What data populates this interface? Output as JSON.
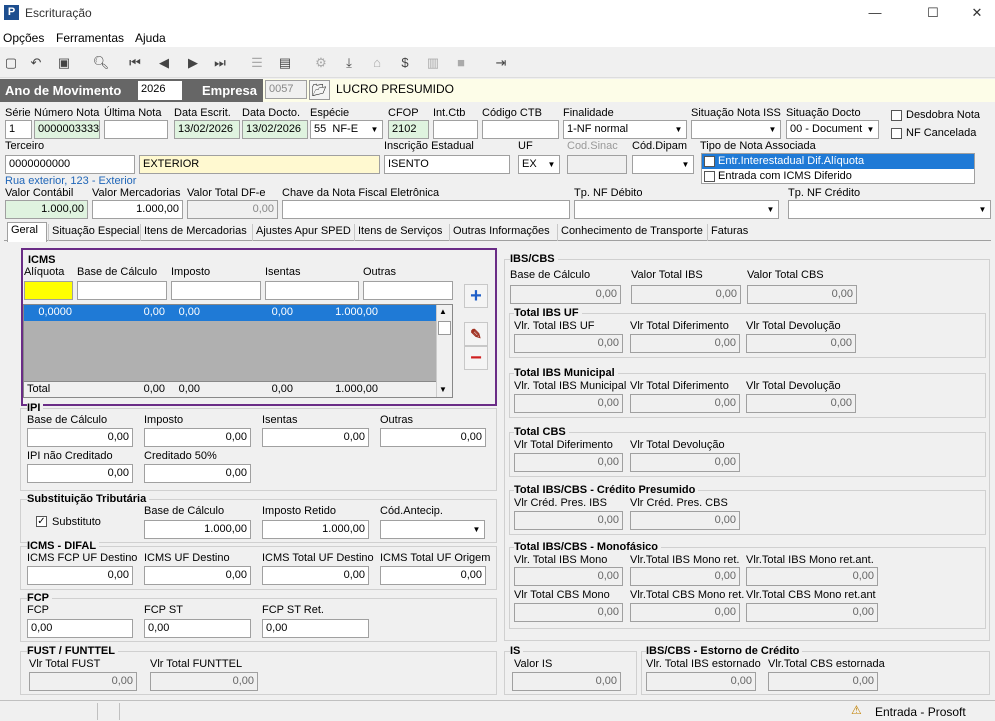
{
  "window": {
    "title": "Escrituração",
    "logo": "P",
    "min": "—",
    "max": "☐",
    "close": "✕"
  },
  "menu": [
    "Opções",
    "Ferramentas",
    "Ajuda"
  ],
  "header": {
    "ano_label": "Ano de Movimento",
    "ano_value": "2026",
    "empresa_label": "Empresa",
    "empresa_code": "0057",
    "empresa_name": "LUCRO PRESUMIDO"
  },
  "nf": {
    "serie_label": "Série",
    "serie": "1",
    "numero_label": "Número Nota",
    "numero": "0000003333",
    "ultima_label": "Última Nota",
    "ultima": "",
    "data_escrit_label": "Data Escrit.",
    "data_escrit": "13/02/2026",
    "data_docto_label": "Data Docto.",
    "data_docto": "13/02/2026",
    "especie_label": "Espécie",
    "especie_code": "55",
    "especie": "NF-E",
    "cfop_label": "CFOP",
    "cfop": "2102",
    "intctb_label": "Int.Ctb",
    "intctb": "",
    "codctb_label": "Código CTB",
    "codctb": "",
    "finalidade_label": "Finalidade",
    "finalidade": "1-NF normal",
    "sitiss_label": "Situação Nota ISS",
    "sitiss": "",
    "sitdocto_label": "Situação Docto",
    "sitdocto": "00 - Document",
    "desdobra_label": "Desdobra Nota",
    "nfcanc_label": "NF Cancelada",
    "terceiro_label": "Terceiro",
    "terceiro_code": "0000000000",
    "terceiro_name": "EXTERIOR",
    "endereco": "Rua exterior, 123 - Exterior",
    "ie_label": "Inscrição Estadual",
    "ie": "ISENTO",
    "uf_label": "UF",
    "uf": "EX",
    "codsinac_label": "Cod.Sinac",
    "codsinac": "",
    "coddipam_label": "Cód.Dipam",
    "coddipam": "",
    "tipo_assoc_label": "Tipo de Nota Associada",
    "tipo_assoc_opts": [
      "Entr.Interestadual Dif.Alíquota",
      "Entrada com ICMS Diferido"
    ],
    "vcontabil_label": "Valor Contábil",
    "vcontabil": "1.000,00",
    "vmerc_label": "Valor Mercadorias",
    "vmerc": "1.000,00",
    "vdfe_label": "Valor Total DF-e",
    "vdfe": "0,00",
    "chave_label": "Chave da Nota Fiscal Eletrônica",
    "chave": "",
    "tpdeb_label": "Tp. NF Débito",
    "tpdeb": "",
    "tpcred_label": "Tp. NF Crédito",
    "tpcred": ""
  },
  "tabs": [
    "Geral",
    "Situação Especial",
    "Itens de Mercadorias",
    "Ajustes Apur SPED",
    "Itens de Serviços",
    "Outras Informações",
    "Conhecimento de Transporte",
    "Faturas"
  ],
  "icms": {
    "title": "ICMS",
    "aliquota_label": "Alíquota",
    "bc_label": "Base de Cálculo",
    "imposto_label": "Imposto",
    "isentas_label": "Isentas",
    "outras_label": "Outras",
    "row": [
      "0,0000",
      "0,00",
      "0,00",
      "0,00",
      "1.000,00"
    ],
    "total_label": "Total",
    "total": [
      "0,00",
      "0,00",
      "0,00",
      "1.000,00"
    ],
    "add": "+",
    "edit": "✎",
    "remove": "−"
  },
  "ipi": {
    "title": "IPI",
    "bc_label": "Base de Cálculo",
    "bc": "0,00",
    "imposto_label": "Imposto",
    "imposto": "0,00",
    "isentas_label": "Isentas",
    "isentas": "0,00",
    "outras_label": "Outras",
    "outras": "0,00",
    "naocred_label": "IPI não Creditado",
    "naocred": "0,00",
    "cred50_label": "Creditado 50%",
    "cred50": "0,00"
  },
  "st": {
    "title": "Substituição Tributária",
    "substituto_label": "Substituto",
    "bc_label": "Base de Cálculo",
    "bc": "1.000,00",
    "retido_label": "Imposto Retido",
    "retido": "1.000,00",
    "antecip_label": "Cód.Antecip.",
    "antecip": ""
  },
  "difal": {
    "title": "ICMS - DIFAL",
    "fcp_label": "ICMS FCP UF Destino",
    "fcp": "0,00",
    "ufdest_label": "ICMS UF Destino",
    "ufdest": "0,00",
    "totdest_label": "ICMS Total UF Destino",
    "totdest": "0,00",
    "totorig_label": "ICMS Total UF Origem",
    "totorig": "0,00"
  },
  "fcp": {
    "title": "FCP",
    "fcp_label": "FCP",
    "fcp": "0,00",
    "st_label": "FCP ST",
    "st": "0,00",
    "ret_label": "FCP ST Ret.",
    "ret": "0,00"
  },
  "fust": {
    "title": "FUST / FUNTTEL",
    "fust_label": "Vlr Total FUST",
    "fust": "0,00",
    "funttel_label": "Vlr Total FUNTTEL",
    "funttel": "0,00"
  },
  "ibscbs": {
    "title": "IBS/CBS",
    "bc_label": "Base de Cálculo",
    "bc": "0,00",
    "ibs_label": "Valor Total IBS",
    "ibs": "0,00",
    "cbs_label": "Valor Total CBS",
    "cbs": "0,00"
  },
  "ibsuf": {
    "title": "Total IBS UF",
    "a_label": "Vlr. Total IBS UF",
    "a": "0,00",
    "b_label": "Vlr Total Diferimento",
    "b": "0,00",
    "c_label": "Vlr Total Devolução",
    "c": "0,00"
  },
  "ibsmun": {
    "title": "Total IBS Municipal",
    "a_label": "Vlr. Total IBS Municipal",
    "a": "0,00",
    "b_label": "Vlr Total Diferimento",
    "b": "0,00",
    "c_label": "Vlr Total Devolução",
    "c": "0,00"
  },
  "cbs": {
    "title": "Total CBS",
    "a_label": "Vlr Total Diferimento",
    "a": "0,00",
    "b_label": "Vlr Total Devolução",
    "b": "0,00"
  },
  "presumido": {
    "title": "Total IBS/CBS - Crédito Presumido",
    "a_label": "Vlr Créd. Pres. IBS",
    "a": "0,00",
    "b_label": "Vlr Créd. Pres. CBS",
    "b": "0,00"
  },
  "mono": {
    "title": "Total IBS/CBS - Monofásico",
    "a_label": "Vlr. Total IBS Mono",
    "a": "0,00",
    "b_label": "Vlr.Total IBS Mono ret.",
    "b": "0,00",
    "c_label": "Vlr.Total IBS Mono ret.ant.",
    "c": "0,00",
    "d_label": "Vlr Total CBS Mono",
    "d": "0,00",
    "e_label": "Vlr.Total CBS Mono ret.",
    "e": "0,00",
    "f_label": "Vlr.Total CBS Mono ret.ant",
    "f": "0,00"
  },
  "is": {
    "title": "IS",
    "label": "Valor IS",
    "value": "0,00"
  },
  "estorno": {
    "title": "IBS/CBS - Estorno de Crédito",
    "a_label": "Vlr. Total IBS estornado",
    "a": "0,00",
    "b_label": "Vlr.Total CBS estornada",
    "b": "0,00"
  },
  "status": {
    "text": "Entrada - Prosoft"
  }
}
